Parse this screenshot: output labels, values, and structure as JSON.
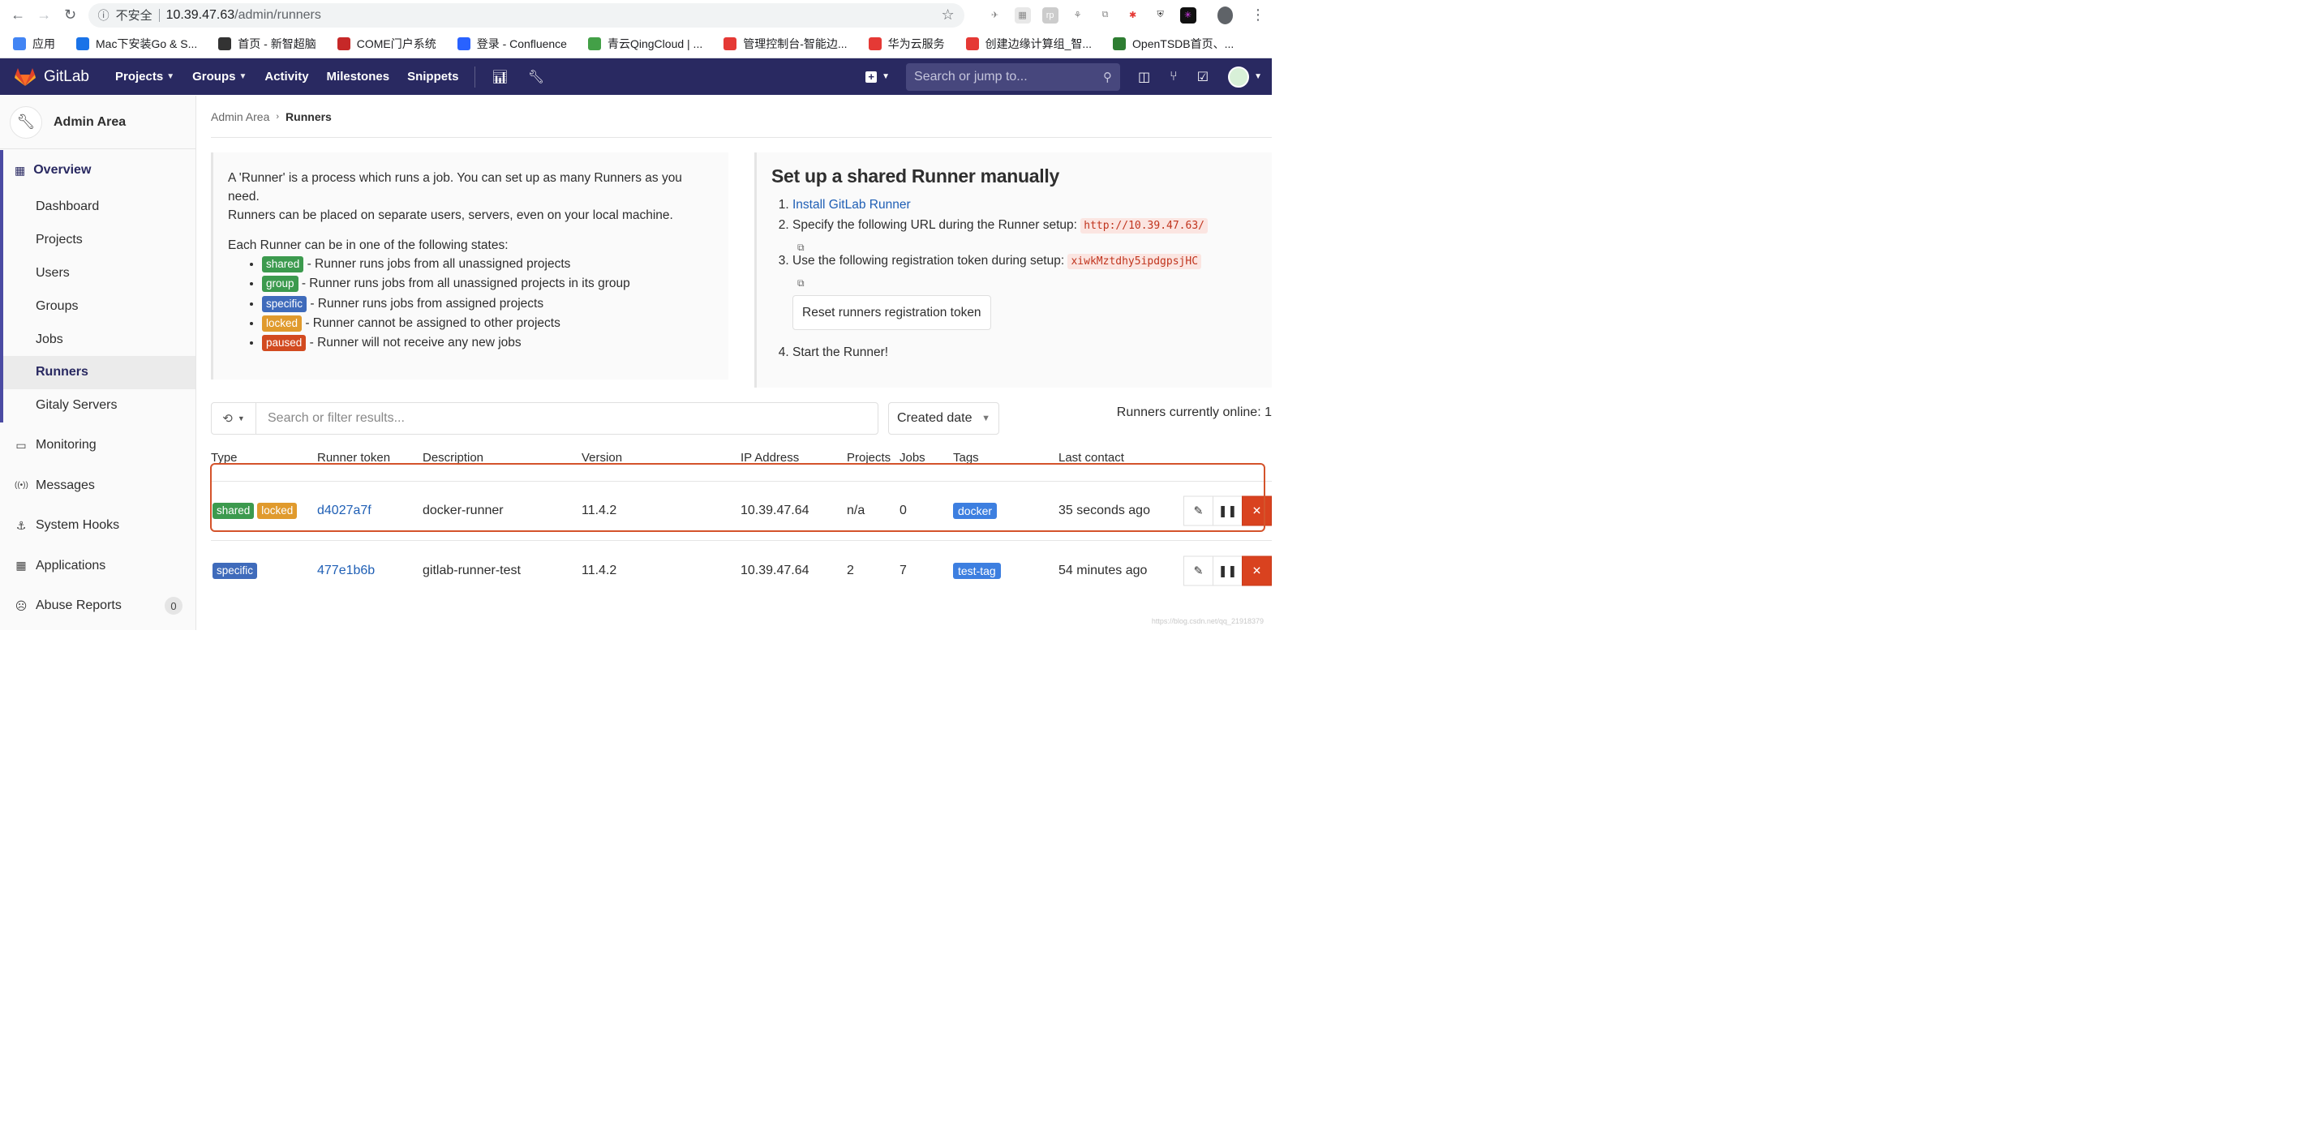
{
  "browser": {
    "insecure_label": "不安全",
    "url_host": "10.39.47.63",
    "url_path": "/admin/runners",
    "bookmarks": [
      {
        "label": "应用",
        "color": "#4285f4"
      },
      {
        "label": "Mac下安装Go & S...",
        "color": "#1a73e8"
      },
      {
        "label": "首页 - 新智超脑",
        "color": "#333333"
      },
      {
        "label": "COME门户系统",
        "color": "#c62828"
      },
      {
        "label": "登录 - Confluence",
        "color": "#2962ff"
      },
      {
        "label": "青云QingCloud | ...",
        "color": "#43a047"
      },
      {
        "label": "管理控制台-智能边...",
        "color": "#e53935"
      },
      {
        "label": "华为云服务",
        "color": "#e53935"
      },
      {
        "label": "创建边缘计算组_智...",
        "color": "#e53935"
      },
      {
        "label": "OpenTSDB首页、...",
        "color": "#2e7d32"
      }
    ]
  },
  "header": {
    "brand": "GitLab",
    "nav": [
      {
        "label": "Projects",
        "has_caret": true
      },
      {
        "label": "Groups",
        "has_caret": true
      },
      {
        "label": "Activity",
        "has_caret": false
      },
      {
        "label": "Milestones",
        "has_caret": false
      },
      {
        "label": "Snippets",
        "has_caret": false
      }
    ],
    "search_placeholder": "Search or jump to...",
    "colors": {
      "bg": "#292961",
      "search_bg": "#47477d"
    }
  },
  "sidebar": {
    "title": "Admin Area",
    "overview": "Overview",
    "overview_items": [
      "Dashboard",
      "Projects",
      "Users",
      "Groups",
      "Jobs",
      "Runners",
      "Gitaly Servers"
    ],
    "active_item": "Runners",
    "main_items": [
      {
        "label": "Monitoring",
        "icon": "monitor-icon"
      },
      {
        "label": "Messages",
        "icon": "broadcast-icon"
      },
      {
        "label": "System Hooks",
        "icon": "hook-icon"
      },
      {
        "label": "Applications",
        "icon": "grid-icon"
      },
      {
        "label": "Abuse Reports",
        "icon": "abuse-icon",
        "count": "0"
      }
    ]
  },
  "breadcrumb": {
    "root": "Admin Area",
    "current": "Runners"
  },
  "info": {
    "line1": "A 'Runner' is a process which runs a job. You can set up as many Runners as you need.",
    "line2": "Runners can be placed on separate users, servers, even on your local machine.",
    "states_intro": "Each Runner can be in one of the following states:",
    "states": [
      {
        "label": "shared",
        "desc": " - Runner runs jobs from all unassigned projects"
      },
      {
        "label": "group",
        "desc": " - Runner runs jobs from all unassigned projects in its group"
      },
      {
        "label": "specific",
        "desc": " - Runner runs jobs from assigned projects"
      },
      {
        "label": "locked",
        "desc": " - Runner cannot be assigned to other projects"
      },
      {
        "label": "paused",
        "desc": " - Runner will not receive any new jobs"
      }
    ]
  },
  "setup": {
    "title": "Set up a shared Runner manually",
    "step1_link": "Install GitLab Runner",
    "step2_text": "Specify the following URL during the Runner setup: ",
    "step2_url": "http://10.39.47.63/",
    "step3_text": "Use the following registration token during setup: ",
    "step3_token": "xiwkMztdhy5ipdgpsjHC",
    "reset_button": "Reset runners registration token",
    "step4_text": "Start the Runner!"
  },
  "filter": {
    "placeholder": "Search or filter results...",
    "sort_label": "Created date",
    "online_label": "Runners currently online: 1"
  },
  "table": {
    "headers": [
      "Type",
      "Runner token",
      "Description",
      "Version",
      "IP Address",
      "Projects",
      "Jobs",
      "Tags",
      "Last contact"
    ],
    "rows": [
      {
        "types": [
          "shared",
          "locked"
        ],
        "token": "d4027a7f",
        "description": "docker-runner",
        "version": "11.4.2",
        "ip": "10.39.47.64",
        "projects": "n/a",
        "jobs": "0",
        "tag": "docker",
        "last_contact": "35 seconds ago"
      },
      {
        "types": [
          "specific"
        ],
        "token": "477e1b6b",
        "description": "gitlab-runner-test",
        "version": "11.4.2",
        "ip": "10.39.47.64",
        "projects": "2",
        "jobs": "7",
        "tag": "test-tag",
        "last_contact": "54 minutes ago"
      }
    ]
  },
  "watermark": "https://blog.csdn.net/qq_21918379"
}
